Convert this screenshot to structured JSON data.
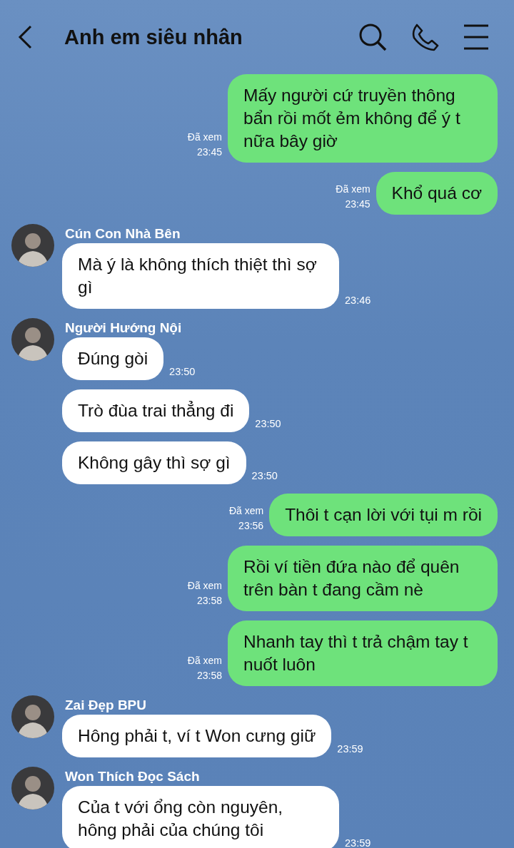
{
  "header": {
    "title": "Anh em siêu nhân"
  },
  "messages": [
    {
      "kind": "out",
      "text": "Mấy người cứ truyền thông bẩn rồi mốt ẻm không để ý t nữa bây giờ",
      "read": "Đã xem",
      "time": "23:45"
    },
    {
      "kind": "out",
      "text": "Khổ quá cơ",
      "read": "Đã xem",
      "time": "23:45"
    },
    {
      "kind": "in",
      "sender": "Cún Con Nhà Bên",
      "text": "Mà ý là không thích thiệt thì sợ gì",
      "time": "23:46"
    },
    {
      "kind": "in",
      "sender": "Người Hướng Nội",
      "text": "Đúng gòi",
      "time": "23:50"
    },
    {
      "kind": "in",
      "text": "Trò đùa trai thẳng đi",
      "time": "23:50"
    },
    {
      "kind": "in",
      "text": "Không gây thì sợ gì",
      "time": "23:50"
    },
    {
      "kind": "out",
      "text": "Thôi t cạn lời với tụi m rồi",
      "read": "Đã xem",
      "time": "23:56"
    },
    {
      "kind": "out",
      "text": "Rồi ví tiền đứa nào để quên trên bàn t đang cầm nè",
      "read": "Đã xem",
      "time": "23:58"
    },
    {
      "kind": "out",
      "text": "Nhanh tay thì t trả chậm tay t nuốt luôn",
      "read": "Đã xem",
      "time": "23:58"
    },
    {
      "kind": "in",
      "sender": "Zai Đẹp BPU",
      "text": "Hông phải t, ví t Won cưng giữ",
      "time": "23:59"
    },
    {
      "kind": "in",
      "sender": "Won Thích Đọc Sách",
      "text": "Của t với ổng còn nguyên, hông phải của chúng tôi",
      "time": "23:59"
    }
  ]
}
